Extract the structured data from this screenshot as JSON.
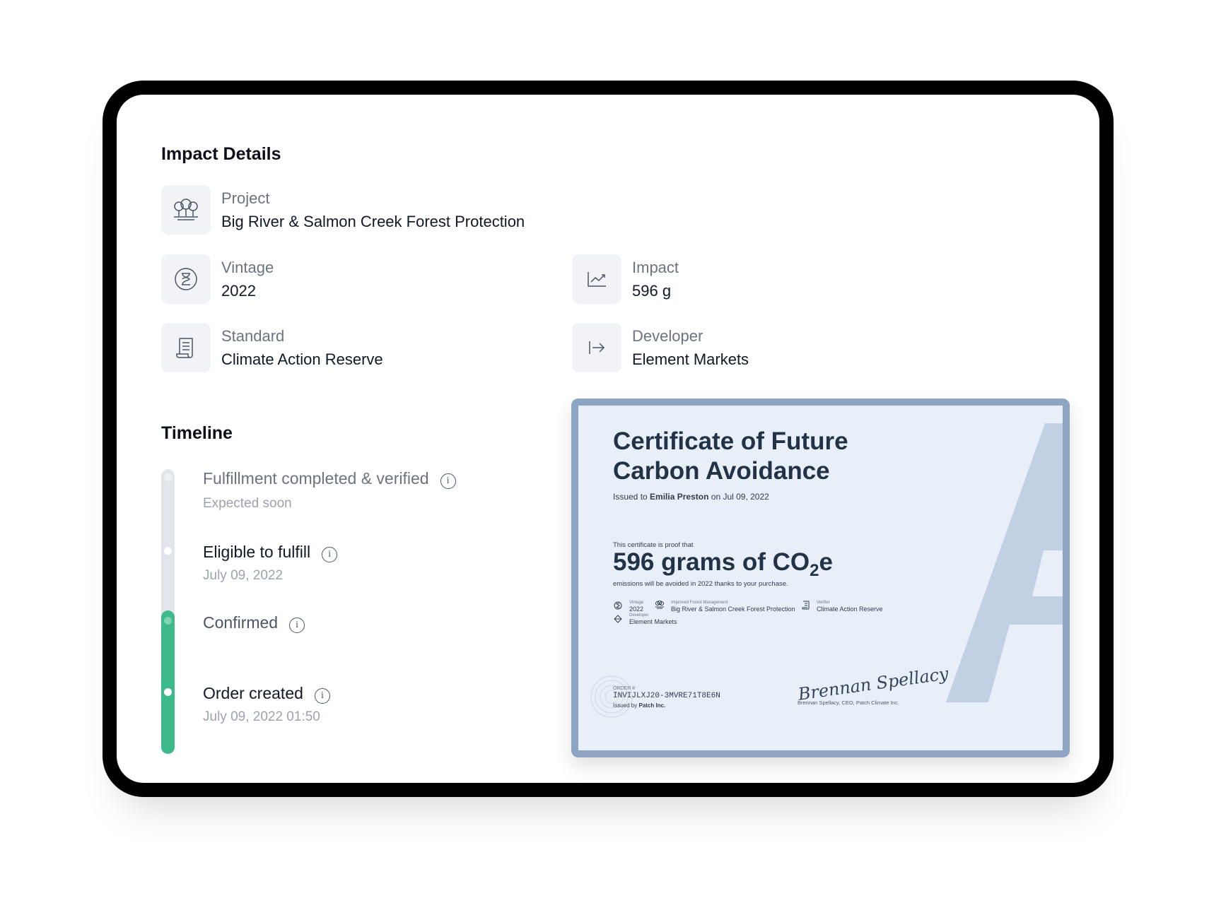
{
  "impact": {
    "heading": "Impact Details",
    "project": {
      "label": "Project",
      "value": "Big River & Salmon Creek Forest Protection"
    },
    "vintage": {
      "label": "Vintage",
      "value": "2022"
    },
    "impact": {
      "label": "Impact",
      "value": "596 g"
    },
    "standard": {
      "label": "Standard",
      "value": "Climate Action Reserve"
    },
    "developer": {
      "label": "Developer",
      "value": "Element Markets"
    }
  },
  "timeline": {
    "heading": "Timeline",
    "items": [
      {
        "title": "Fulfillment completed & verified",
        "subtitle": "Expected soon",
        "status": "pending"
      },
      {
        "title": "Eligible to fulfill",
        "subtitle": "July 09, 2022",
        "status": "pending"
      },
      {
        "title": "Confirmed",
        "subtitle": "",
        "status": "done"
      },
      {
        "title": "Order created",
        "subtitle": "July 09, 2022 01:50",
        "status": "done"
      }
    ],
    "info_glyph": "i"
  },
  "certificate": {
    "title_line1": "Certificate of Future",
    "title_line2": "Carbon Avoidance",
    "issued_prefix": "Issued to",
    "recipient": "Emilia Preston",
    "issued_on": "on Jul 09, 2022",
    "proof_text": "This certificate is proof that",
    "amount_main": "596 grams of CO",
    "amount_sub": "2",
    "amount_suffix": "e",
    "emissions_text": "emissions will be avoided in 2022 thanks to your purchase.",
    "vintage_label": "Vintage",
    "vintage_value": "2022",
    "project_label": "Improved Forest Management",
    "project_value": "Big River & Salmon Creek Forest Protection",
    "verifier_label": "Verifier",
    "verifier_value": "Climate Action Reserve",
    "developer_label": "Developer",
    "developer_value": "Element Markets",
    "order_label": "ORDER #",
    "order_id": "INVIJLXJ20-3MVRE71T8E6N",
    "issued_by_prefix": "Issued by",
    "issuer": "Patch Inc.",
    "signature_caption": "Brennan Spellacy, CEO, Patch Climate Inc.",
    "signature_text": "Brennan Spellacy"
  },
  "colors": {
    "accent": "#3dba8c",
    "track": "#e2e5ea",
    "cert_border": "#8da4c2",
    "cert_bg": "#e9eff8"
  }
}
